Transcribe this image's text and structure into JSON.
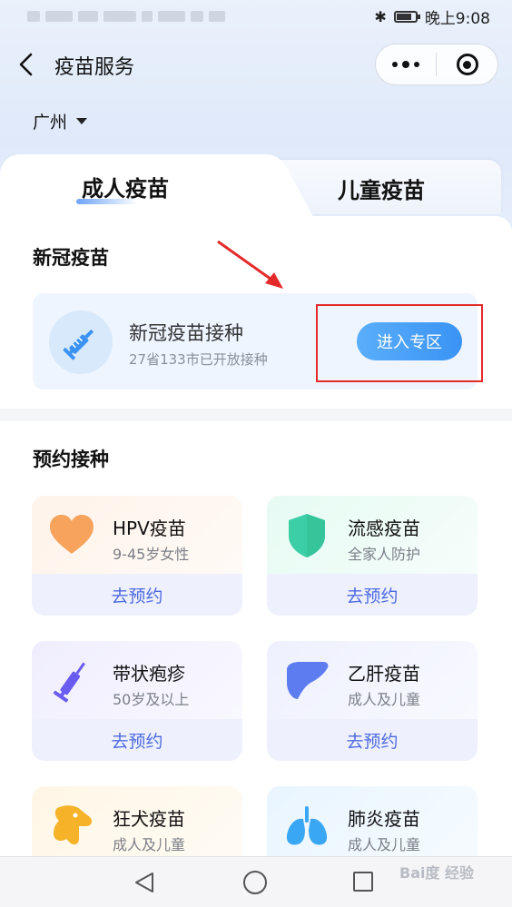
{
  "status_bar": {
    "time": "晚上9:08"
  },
  "nav": {
    "title": "疫苗服务"
  },
  "location": {
    "city": "广州"
  },
  "tabs": [
    {
      "label": "成人疫苗",
      "active": true
    },
    {
      "label": "儿童疫苗",
      "active": false
    }
  ],
  "covid": {
    "section_title": "新冠疫苗",
    "title": "新冠疫苗接种",
    "subtitle": "27省133市已开放接种",
    "button": "进入专区"
  },
  "booking": {
    "section_title": "预约接种",
    "items": [
      {
        "name": "HPV疫苗",
        "desc": "9-45岁女性",
        "action": "去预约",
        "icon": "heart-icon",
        "color": "#f7a35c"
      },
      {
        "name": "流感疫苗",
        "desc": "全家人防护",
        "action": "去预约",
        "icon": "shield-icon",
        "color": "#3ccfa6"
      },
      {
        "name": "带状疱疹",
        "desc": "50岁及以上",
        "action": "去预约",
        "icon": "syringe-icon",
        "color": "#6a5cf0"
      },
      {
        "name": "乙肝疫苗",
        "desc": "成人及儿童",
        "action": "去预约",
        "icon": "liver-icon",
        "color": "#5c7cf0"
      },
      {
        "name": "狂犬疫苗",
        "desc": "成人及儿童",
        "action": "",
        "icon": "dog-icon",
        "color": "#f6b32a"
      },
      {
        "name": "肺炎疫苗",
        "desc": "成人及儿童",
        "action": "",
        "icon": "lungs-icon",
        "color": "#3aa7f5"
      }
    ]
  },
  "watermark": "Bai度 经验",
  "colors": {
    "accent": "#3a93f4",
    "annotation": "#e52a2a"
  }
}
